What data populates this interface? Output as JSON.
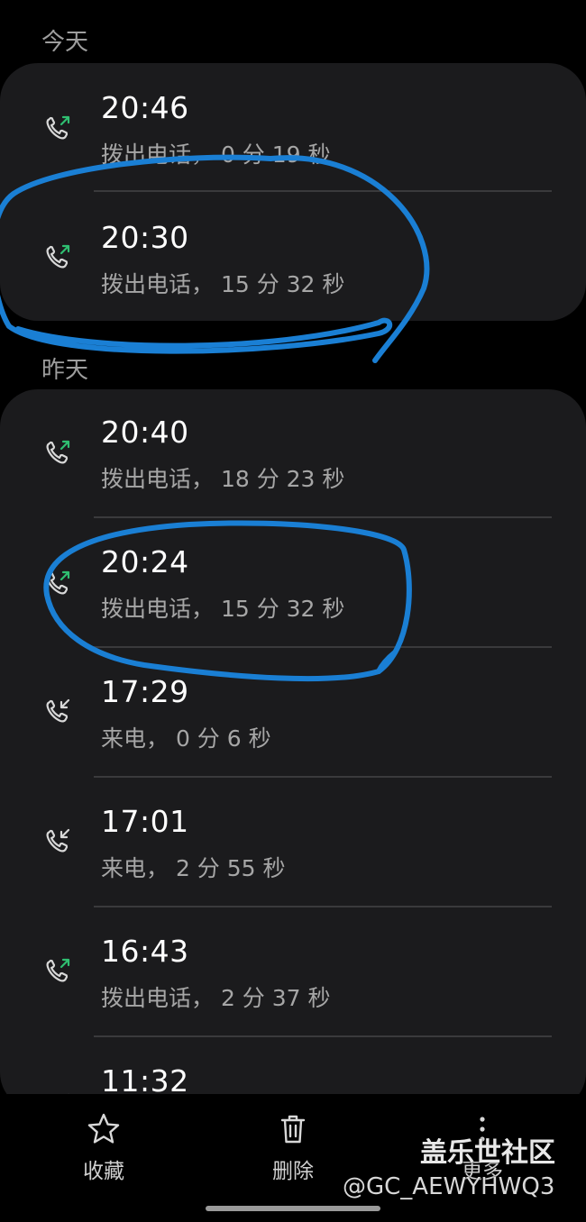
{
  "colors": {
    "background": "#000000",
    "card": "#1b1b1d",
    "outgoing_arrow": "#2fbf71",
    "annotation": "#1a7fd4"
  },
  "sections": [
    {
      "label": "今天",
      "calls": [
        {
          "time": "20:46",
          "detail": "拨出电话， 0 分 19 秒",
          "type": "outgoing",
          "icon": "outgoing-call-icon"
        },
        {
          "time": "20:30",
          "detail": "拨出电话， 15 分 32 秒",
          "type": "outgoing",
          "icon": "outgoing-call-icon"
        }
      ]
    },
    {
      "label": "昨天",
      "calls": [
        {
          "time": "20:40",
          "detail": "拨出电话， 18 分 23 秒",
          "type": "outgoing",
          "icon": "outgoing-call-icon"
        },
        {
          "time": "20:24",
          "detail": "拨出电话， 15 分 32 秒",
          "type": "outgoing",
          "icon": "outgoing-call-icon"
        },
        {
          "time": "17:29",
          "detail": "来电， 0 分 6 秒",
          "type": "incoming",
          "icon": "incoming-call-icon"
        },
        {
          "time": "17:01",
          "detail": "来电， 2 分 55 秒",
          "type": "incoming",
          "icon": "incoming-call-icon"
        },
        {
          "time": "16:43",
          "detail": "拨出电话， 2 分 37 秒",
          "type": "outgoing",
          "icon": "outgoing-call-icon"
        },
        {
          "time": "11:32",
          "type": "incoming",
          "icon": "incoming-call-icon"
        }
      ]
    }
  ],
  "bottom_bar": {
    "favorite_label": "收藏",
    "favorite_icon": "star-icon",
    "delete_label": "删除",
    "delete_icon": "trash-icon",
    "more_label": "更多",
    "more_icon": "more-vertical-icon"
  },
  "watermark": {
    "title": "盖乐世社区",
    "user": "@GC_AEWYHWQ3"
  }
}
